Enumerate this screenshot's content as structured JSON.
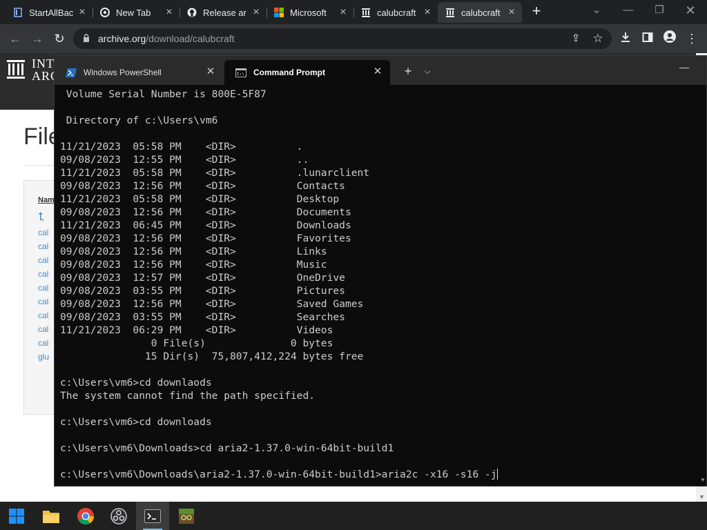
{
  "browser": {
    "tabs": [
      {
        "title": "StartAllBac",
        "icon": "doc-icon"
      },
      {
        "title": "New Tab",
        "icon": "chrome-icon"
      },
      {
        "title": "Release ar",
        "icon": "github-icon"
      },
      {
        "title": "Microsoft",
        "icon": "microsoft-icon"
      },
      {
        "title": "calubcraft",
        "icon": "archive-icon"
      },
      {
        "title": "calubcraft",
        "icon": "archive-icon"
      }
    ],
    "active_tab_index": 5,
    "url_host": "archive.org",
    "url_path": "/download/calubcraft"
  },
  "page": {
    "logo_text_1": "INT",
    "logo_text_2": "ARC",
    "title": "File",
    "column_header": "Nam",
    "links": [
      "cal",
      "cal",
      "cal",
      "cal",
      "cal",
      "cal",
      "cal",
      "cal",
      "cal",
      "glu"
    ]
  },
  "terminal": {
    "tabs": [
      {
        "label": "Windows PowerShell",
        "icon": "powershell-icon"
      },
      {
        "label": "Command Prompt",
        "icon": "cmd-icon"
      }
    ],
    "active_tab_index": 1,
    "lines": [
      " Volume Serial Number is 800E-5F87",
      "",
      " Directory of c:\\Users\\vm6",
      "",
      "11/21/2023  05:58 PM    <DIR>          .",
      "09/08/2023  12:55 PM    <DIR>          ..",
      "11/21/2023  05:58 PM    <DIR>          .lunarclient",
      "09/08/2023  12:56 PM    <DIR>          Contacts",
      "11/21/2023  05:58 PM    <DIR>          Desktop",
      "09/08/2023  12:56 PM    <DIR>          Documents",
      "11/21/2023  06:45 PM    <DIR>          Downloads",
      "09/08/2023  12:56 PM    <DIR>          Favorites",
      "09/08/2023  12:56 PM    <DIR>          Links",
      "09/08/2023  12:56 PM    <DIR>          Music",
      "09/08/2023  12:57 PM    <DIR>          OneDrive",
      "09/08/2023  03:55 PM    <DIR>          Pictures",
      "09/08/2023  12:56 PM    <DIR>          Saved Games",
      "09/08/2023  03:55 PM    <DIR>          Searches",
      "11/21/2023  06:29 PM    <DIR>          Videos",
      "               0 File(s)              0 bytes",
      "              15 Dir(s)  75,807,412,224 bytes free",
      "",
      "c:\\Users\\vm6>cd downlaods",
      "The system cannot find the path specified.",
      "",
      "c:\\Users\\vm6>cd downloads",
      "",
      "c:\\Users\\vm6\\Downloads>cd aria2-1.37.0-win-64bit-build1",
      "",
      "c:\\Users\\vm6\\Downloads\\aria2-1.37.0-win-64bit-build1>aria2c -x16 -s16 -j"
    ]
  },
  "taskbar": {
    "items": [
      {
        "icon": "windows-start-icon",
        "active": false
      },
      {
        "icon": "file-explorer-icon",
        "active": false
      },
      {
        "icon": "chrome-icon",
        "active": false
      },
      {
        "icon": "obs-icon",
        "active": false
      },
      {
        "icon": "terminal-icon",
        "active": true
      },
      {
        "icon": "minecraft-launcher-icon",
        "active": false
      }
    ]
  },
  "colors": {
    "chrome_dark": "#202124",
    "chrome_toolbar": "#35363a",
    "terminal_bg": "#0c0c0c",
    "terminal_text": "#cccccc",
    "taskbar": "#202020",
    "accent": "#76b9ed"
  }
}
